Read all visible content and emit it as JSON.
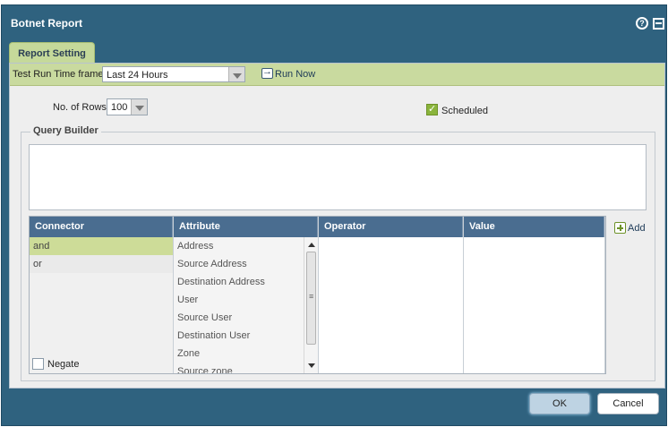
{
  "dialog": {
    "title": "Botnet Report",
    "help_icon": "?"
  },
  "tabs": [
    {
      "label": "Report Setting"
    }
  ],
  "time_frame": {
    "label": "Test Run Time frame:",
    "value": "Last 24 Hours",
    "run_now_label": "Run Now"
  },
  "rows": {
    "label": "No. of Rows",
    "value": "100"
  },
  "scheduled": {
    "label": "Scheduled",
    "checked": true
  },
  "query_builder": {
    "legend": "Query Builder",
    "columns": [
      "Connector",
      "Attribute",
      "Operator",
      "Value"
    ],
    "connectors": [
      "and",
      "or"
    ],
    "attributes": [
      "Address",
      "Source Address",
      "Destination Address",
      "User",
      "Source User",
      "Destination User",
      "Zone",
      "Source zone"
    ],
    "negate_label": "Negate",
    "add_label": "Add"
  },
  "footer": {
    "ok_label": "OK",
    "cancel_label": "Cancel"
  },
  "colors": {
    "titlebar": "#2f627f",
    "accent_green": "#c9da9f",
    "grid_header": "#4a6d90"
  }
}
